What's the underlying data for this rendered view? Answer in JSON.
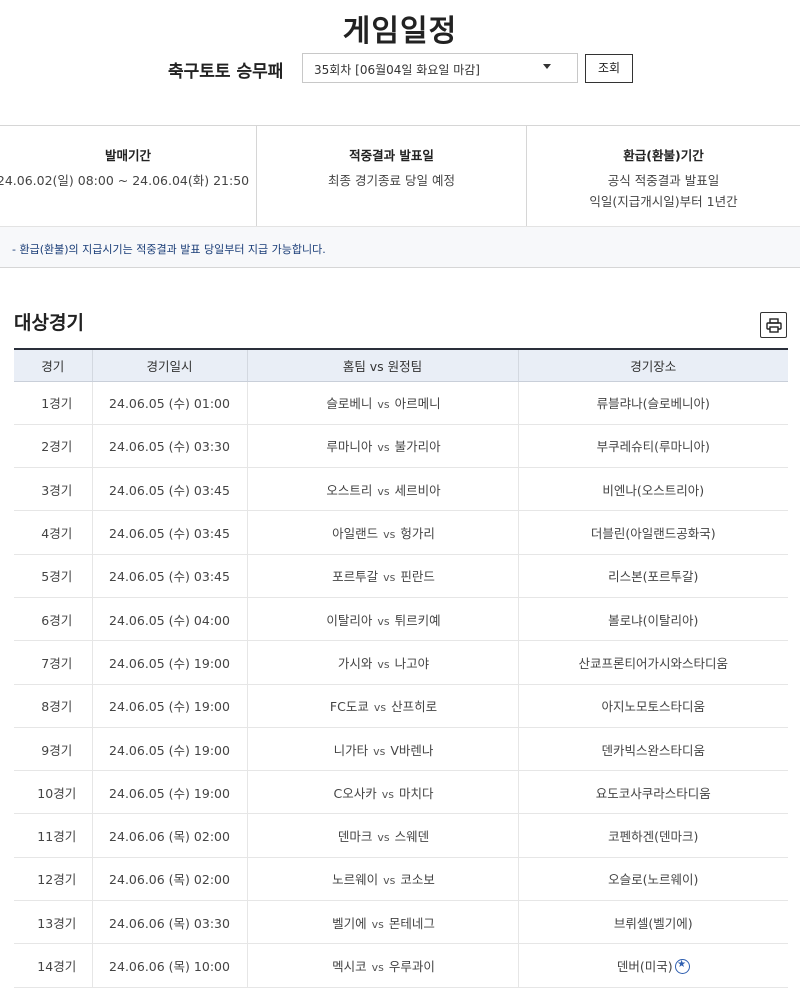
{
  "page_title": "게임일정",
  "game_type": "축구토토 승무패",
  "round_select": {
    "value": "35회차 [06월04일 화요일 마감]"
  },
  "search_button": "조회",
  "info": {
    "sale_period": {
      "title": "발매기간",
      "text": "24.06.02(일) 08:00 ~ 24.06.04(화) 21:50"
    },
    "result_date": {
      "title": "적중결과 발표일",
      "text": "최종 경기종료 당일 예정"
    },
    "refund_period": {
      "title": "환급(환불)기간",
      "line1": "공식 적중결과 발표일",
      "line2": "익일(지급개시일)부터 1년간"
    },
    "note": "- 환급(환불)의 지급시기는 적중결과 발표 당일부터 지급 가능합니다."
  },
  "section_title": "대상경기",
  "table": {
    "headers": {
      "no": "경기",
      "datetime": "경기일시",
      "match": "홈팀 vs 원정팀",
      "venue": "경기장소"
    },
    "vs": "vs",
    "rows": [
      {
        "no": "1경기",
        "datetime": "24.06.05 (수) 01:00",
        "home": "슬로베니",
        "away": "아르메니",
        "venue": "류블랴나(슬로베니아)"
      },
      {
        "no": "2경기",
        "datetime": "24.06.05 (수) 03:30",
        "home": "루마니아",
        "away": "불가리아",
        "venue": "부쿠레슈티(루마니아)"
      },
      {
        "no": "3경기",
        "datetime": "24.06.05 (수) 03:45",
        "home": "오스트리",
        "away": "세르비아",
        "venue": "비엔나(오스트리아)"
      },
      {
        "no": "4경기",
        "datetime": "24.06.05 (수) 03:45",
        "home": "아일랜드",
        "away": "헝가리",
        "venue": "더블린(아일랜드공화국)"
      },
      {
        "no": "5경기",
        "datetime": "24.06.05 (수) 03:45",
        "home": "포르투갈",
        "away": "핀란드",
        "venue": "리스본(포르투갈)"
      },
      {
        "no": "6경기",
        "datetime": "24.06.05 (수) 04:00",
        "home": "이탈리아",
        "away": "튀르키예",
        "venue": "볼로냐(이탈리아)"
      },
      {
        "no": "7경기",
        "datetime": "24.06.05 (수) 19:00",
        "home": "가시와",
        "away": "나고야",
        "venue": "산쿄프론티어가시와스타디움"
      },
      {
        "no": "8경기",
        "datetime": "24.06.05 (수) 19:00",
        "home": "FC도쿄",
        "away": "산프히로",
        "venue": "아지노모토스타디움"
      },
      {
        "no": "9경기",
        "datetime": "24.06.05 (수) 19:00",
        "home": "니가타",
        "away": "V바렌나",
        "venue": "덴카빅스완스타디움"
      },
      {
        "no": "10경기",
        "datetime": "24.06.05 (수) 19:00",
        "home": "C오사카",
        "away": "마치다",
        "venue": "요도코사쿠라스타디움"
      },
      {
        "no": "11경기",
        "datetime": "24.06.06 (목) 02:00",
        "home": "덴마크",
        "away": "스웨덴",
        "venue": "코펜하겐(덴마크)"
      },
      {
        "no": "12경기",
        "datetime": "24.06.06 (목) 02:00",
        "home": "노르웨이",
        "away": "코소보",
        "venue": "오슬로(노르웨이)"
      },
      {
        "no": "13경기",
        "datetime": "24.06.06 (목) 03:30",
        "home": "벨기에",
        "away": "몬테네그",
        "venue": "브뤼셀(벨기에)"
      },
      {
        "no": "14경기",
        "datetime": "24.06.06 (목) 10:00",
        "home": "멕시코",
        "away": "우루과이",
        "venue": "덴버(미국)"
      }
    ]
  },
  "colors": {
    "header_bg": "#e9eef6",
    "note_text": "#1a3d77",
    "accent": "#2f5fb0"
  }
}
